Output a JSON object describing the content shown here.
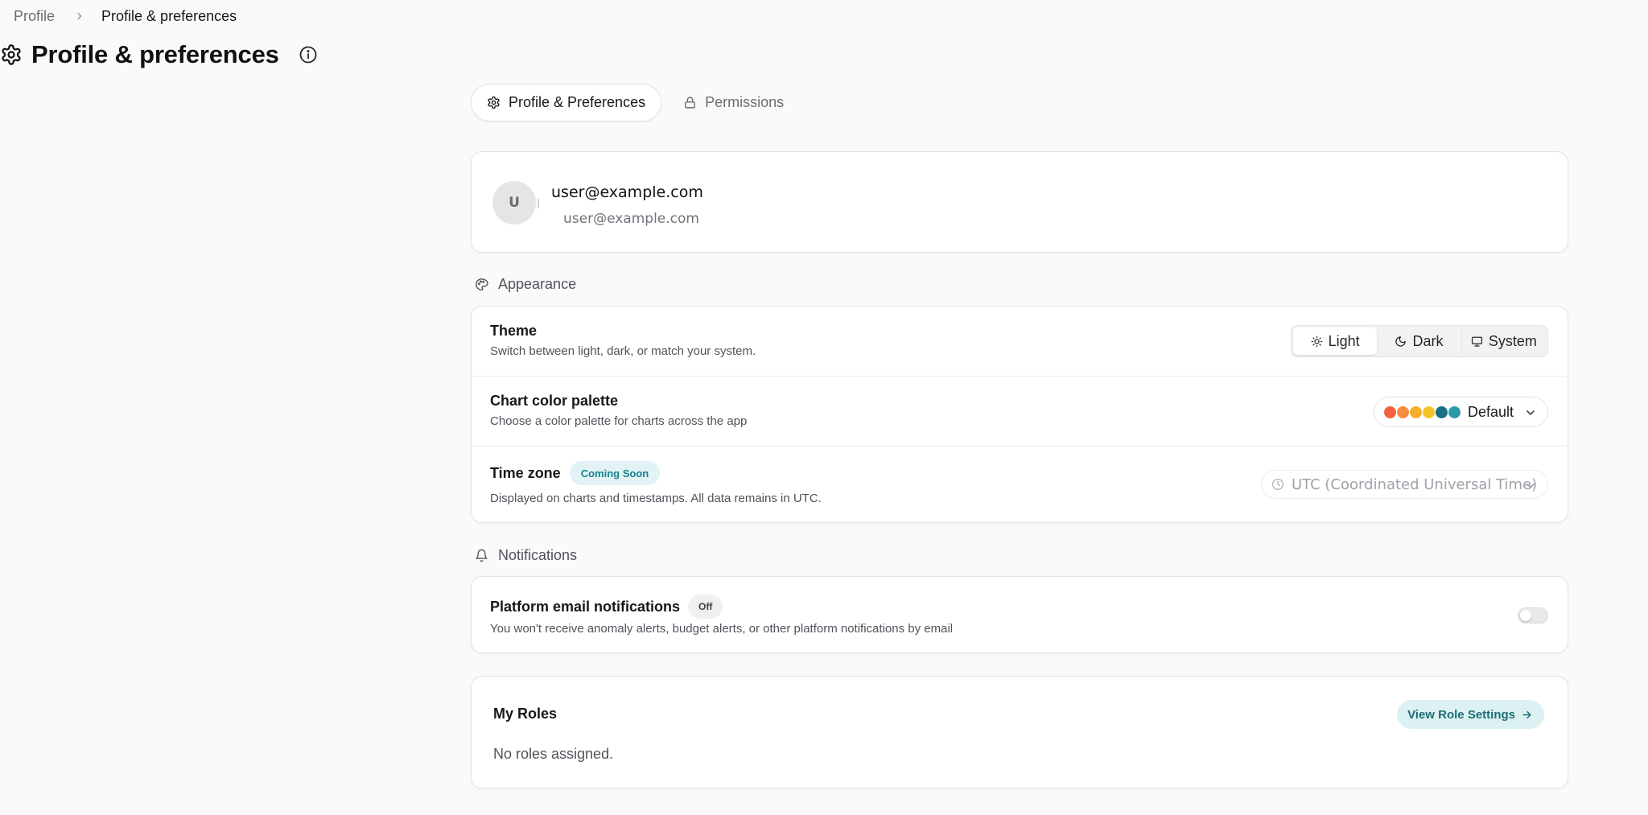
{
  "breadcrumb": {
    "parent": "Profile",
    "current": "Profile & preferences"
  },
  "page": {
    "title": "Profile & preferences",
    "title_icon": "gear-icon",
    "info_icon": "info-icon"
  },
  "tabs": [
    {
      "label": "Profile & Preferences",
      "icon": "gear-icon",
      "active": true
    },
    {
      "label": "Permissions",
      "icon": "lock-icon",
      "active": false
    }
  ],
  "profile": {
    "avatar_initial": "U",
    "email": "user@example.com",
    "subtitle": "user@example.com"
  },
  "appearance": {
    "heading": "Appearance",
    "icon": "palette-icon",
    "theme": {
      "title": "Theme",
      "description": "Switch between light, dark, or match your system.",
      "options": [
        {
          "label": "Light",
          "icon": "sun-icon"
        },
        {
          "label": "Dark",
          "icon": "moon-icon"
        },
        {
          "label": "System",
          "icon": "monitor-icon"
        }
      ],
      "selected": "Light"
    },
    "palette": {
      "title": "Chart color palette",
      "description": "Choose a color palette for charts across the app",
      "selected": "Default",
      "swatches": [
        "#f2603f",
        "#f28d3f",
        "#f5ad2a",
        "#f2c529",
        "#1b6f84",
        "#2a9aaa"
      ]
    },
    "timezone": {
      "title": "Time zone",
      "badge": "Coming Soon",
      "description": "Displayed on charts and timestamps. All data remains in UTC.",
      "selected": "UTC (Coordinated Universal Time)"
    }
  },
  "notifications": {
    "heading": "Notifications",
    "icon": "bell-icon",
    "email": {
      "title": "Platform email notifications",
      "badge": "Off",
      "description": "You won't receive anomaly alerts, budget alerts, or other platform notifications by email",
      "enabled": false
    }
  },
  "roles": {
    "title": "My Roles",
    "empty_text": "No roles assigned.",
    "button_label": "View Role Settings"
  },
  "colors": {
    "accent": "#1d6d77",
    "accent_bg": "#dcf1f2",
    "background": "#fafafa"
  }
}
